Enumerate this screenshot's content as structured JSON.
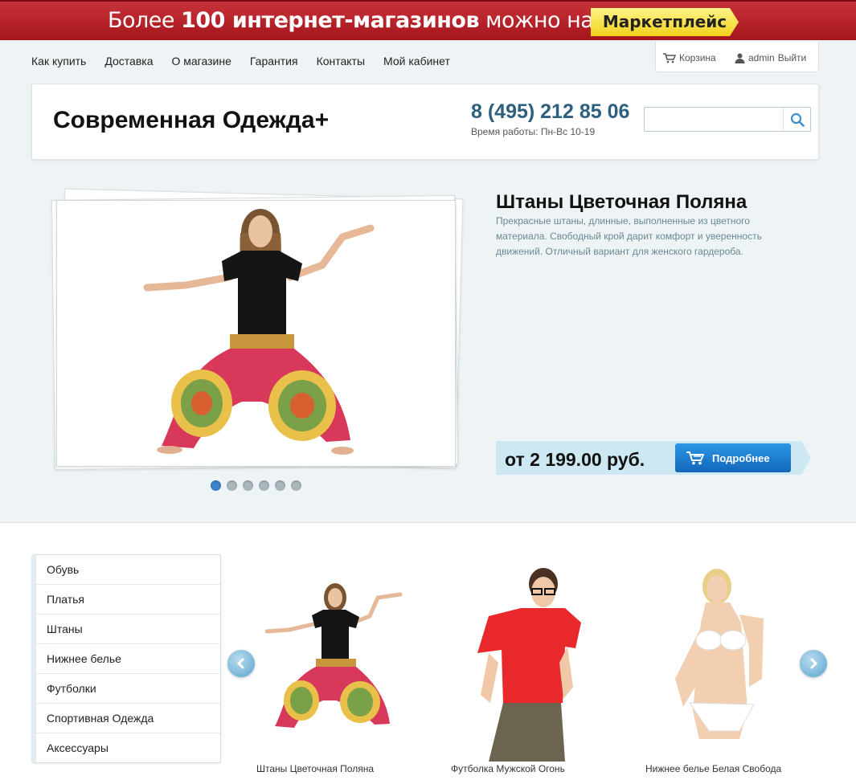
{
  "banner": {
    "prefix": "Более ",
    "bold": "100 интернет-магазинов",
    "suffix": " можно найти в",
    "button": "Маркетплейс"
  },
  "nav": [
    "Как купить",
    "Доставка",
    "О магазине",
    "Гарантия",
    "Контакты",
    "Мой кабинет"
  ],
  "userbox": {
    "cart": "Корзина",
    "user": "admin",
    "logout": "Выйти"
  },
  "header": {
    "logo": "Современная Одежда+",
    "phone": "8 (495) 212 85 06",
    "hours": "Время работы: Пн-Вс 10-19",
    "search_value": ""
  },
  "slider": {
    "title": "Штаны Цветочная Поляна",
    "description": "Прекрасные штаны, длинные, выполненные из цветного материала. Свободный крой дарит комфорт и уверенность движений. Отличный вариант для женского гардероба.",
    "price": "от 2 199.00 руб.",
    "button": "Подробнее",
    "dots_total": 6,
    "active_dot": 1
  },
  "categories": [
    "Обувь",
    "Платья",
    "Штаны",
    "Нижнее белье",
    "Футболки",
    "Спортивная Одежда",
    "Аксессуары"
  ],
  "products": [
    {
      "name": "Штаны Цветочная Поляна"
    },
    {
      "name": "Футболка Мужской Огонь"
    },
    {
      "name": "Нижнее белье Белая Свобода"
    }
  ],
  "colors": {
    "banner_red": "#b3222a",
    "accent_blue": "#1a7fd4",
    "phone_blue": "#2d5f7e",
    "price_bar": "#cde7f3"
  }
}
